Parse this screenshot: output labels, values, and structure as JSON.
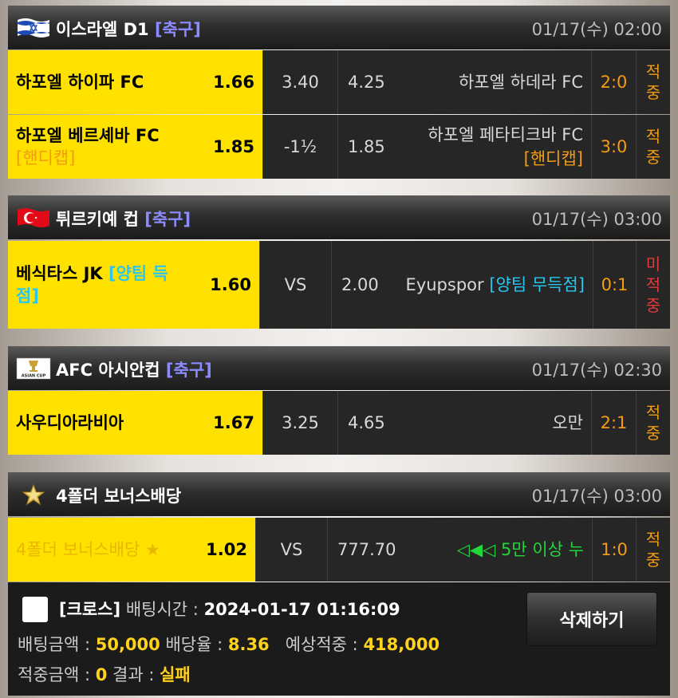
{
  "matches": [
    {
      "league": "이스라엘 D1",
      "sport": "[축구]",
      "datetime": "01/17(수) 02:00",
      "flag": "israel-flag",
      "rows": [
        {
          "home": "하포엘 하이파 FC",
          "home_tag": "",
          "home_odd": "1.66",
          "mid": "3.40",
          "away_odd": "4.25",
          "away": "하포엘 하데라 FC",
          "away_tag": "",
          "score": "2:0",
          "result": "적중"
        },
        {
          "home": "하포엘 베르셰바 FC",
          "home_tag": "[핸디캡]",
          "home_odd": "1.85",
          "mid": "-1½",
          "away_odd": "1.85",
          "away": "하포엘 페타티크바 FC",
          "away_tag": "[핸디캡]",
          "score": "3:0",
          "result": "적중"
        }
      ]
    },
    {
      "league": "튀르키예 컵",
      "sport": "[축구]",
      "datetime": "01/17(수) 03:00",
      "flag": "turkey-flag",
      "rows": [
        {
          "home": "베식타스 JK",
          "home_tag": "[양팀 득점]",
          "home_odd": "1.60",
          "mid": "VS",
          "away_odd": "2.00",
          "away": "Eyupspor",
          "away_tag": "[양팀 무득점]",
          "score": "0:1",
          "result": "미적중"
        }
      ]
    },
    {
      "league": "AFC 아시안컵",
      "sport": "[축구]",
      "datetime": "01/17(수) 02:30",
      "flag": "asian-cup-logo",
      "logo_text": "ASIAN CUP",
      "rows": [
        {
          "home": "사우디아라비아",
          "home_odd": "1.67",
          "mid": "3.25",
          "away_odd": "4.65",
          "away": "오만",
          "score": "2:1",
          "result": "적중"
        }
      ]
    },
    {
      "league": "4폴더 보너스배당",
      "datetime": "01/17(수) 03:00",
      "flag": "star-icon",
      "rows": [
        {
          "home": "4폴더 보너스배당 ★",
          "home_odd": "1.02",
          "mid": "VS",
          "away_odd": "777.70",
          "away": "◁◀◁ 5만 이상 누",
          "score": "1:0",
          "result": "적중"
        }
      ]
    }
  ],
  "summary": {
    "type": "[크로스]",
    "bet_time_label": "배팅시간 :",
    "bet_time": "2024-01-17 01:16:09",
    "bet_amount_label": "배팅금액 :",
    "bet_amount": "50,000",
    "odds_label": "배당율 :",
    "odds": "8.36",
    "expected_label": "예상적중 :",
    "expected": "418,000",
    "win_amount_label": "적중금액 :",
    "win_amount": "0",
    "result_label": "결과 :",
    "result": "실패",
    "delete_label": "삭제하기"
  },
  "colors": {
    "home_bg": "#ffe100",
    "sport": "#8c8cff",
    "score": "#f39c12",
    "miss": "#e83a3a",
    "tag": "#29c6f0",
    "bonus": "#22d63a",
    "value": "#ffd21c"
  }
}
